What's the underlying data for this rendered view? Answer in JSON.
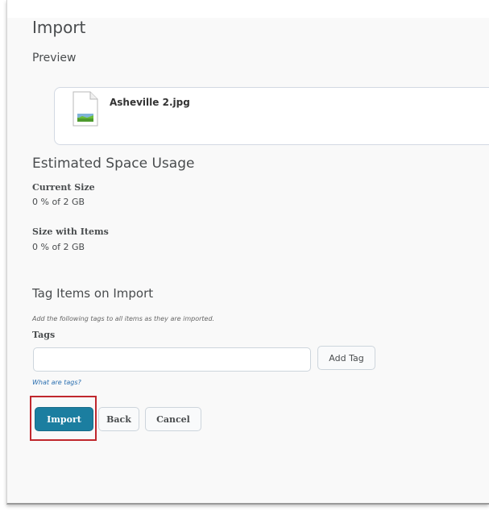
{
  "page": {
    "title": "Import",
    "preview_heading": "Preview"
  },
  "preview": {
    "file_name": "Asheville 2.jpg",
    "file_icon": "image-file-icon"
  },
  "space_usage": {
    "heading": "Estimated Space Usage",
    "current_size_label": "Current Size",
    "current_size_value": "0 % of 2 GB",
    "size_with_items_label": "Size with Items",
    "size_with_items_value": "0 % of 2 GB"
  },
  "tags": {
    "heading": "Tag Items on Import",
    "hint": "Add the following tags to all items as they are imported.",
    "label": "Tags",
    "input_value": "",
    "add_button": "Add Tag",
    "help_link": "What are tags?"
  },
  "actions": {
    "import": "Import",
    "back": "Back",
    "cancel": "Cancel"
  },
  "colors": {
    "primary": "#1b7ea0",
    "highlight": "#c0272d"
  }
}
